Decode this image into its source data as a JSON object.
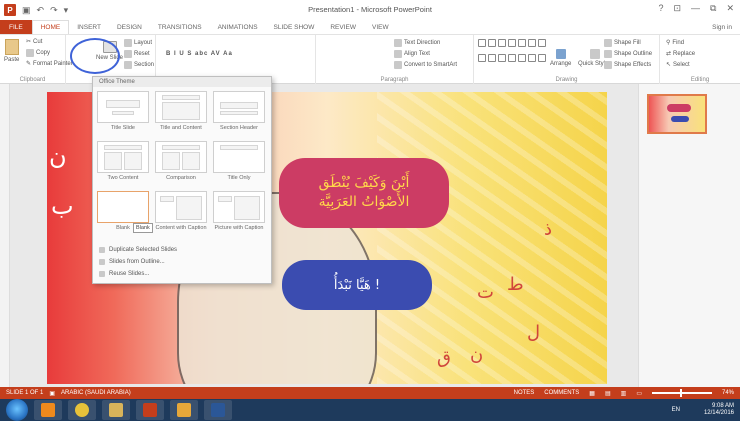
{
  "window": {
    "title": "Presentation1 - Microsoft PowerPoint",
    "controls": [
      "?",
      "⊡",
      "—",
      "⧉",
      "✕"
    ],
    "sign_in": "Sign in"
  },
  "tabs": [
    "FILE",
    "HOME",
    "INSERT",
    "DESIGN",
    "TRANSITIONS",
    "ANIMATIONS",
    "SLIDE SHOW",
    "REVIEW",
    "VIEW"
  ],
  "ribbon": {
    "clipboard": {
      "paste": "Paste",
      "cut": "Cut",
      "copy": "Copy",
      "format_painter": "Format Painter",
      "label": "Clipboard"
    },
    "slides": {
      "new_slide": "New Slide",
      "layout": "Layout",
      "reset": "Reset",
      "section": "Section"
    },
    "font": {
      "buttons": "B  I  U  S  abc  AV  Aa"
    },
    "paragraph": {
      "label": "Paragraph",
      "text_direction": "Text Direction",
      "align_text": "Align Text",
      "convert": "Convert to SmartArt"
    },
    "drawing": {
      "arrange": "Arrange",
      "quick_styles": "Quick Styles",
      "shape_fill": "Shape Fill",
      "shape_outline": "Shape Outline",
      "shape_effects": "Shape Effects",
      "label": "Drawing"
    },
    "editing": {
      "find": "Find",
      "replace": "Replace",
      "select": "Select",
      "label": "Editing"
    }
  },
  "dropdown": {
    "title": "Office Theme",
    "layouts": [
      {
        "label": "Title Slide"
      },
      {
        "label": "Title and Content"
      },
      {
        "label": "Section Header"
      },
      {
        "label": "Two Content"
      },
      {
        "label": "Comparison"
      },
      {
        "label": "Title Only"
      },
      {
        "label": "Blank"
      },
      {
        "label": "Content with Caption"
      },
      {
        "label": "Picture with Caption"
      }
    ],
    "tooltip": "Blank",
    "items": [
      "Duplicate Selected Slides",
      "Slides from Outline...",
      "Reuse Slides..."
    ]
  },
  "slide": {
    "line1": "أَيْنَ وَكَيْفَ يُنْطَق",
    "line2": "الأَصْوَاتُ العَرَبِيَّة",
    "button_text": "هَيَّا نَبْدَأُ !",
    "letters": [
      "ن",
      "ب",
      "ذ",
      "ط",
      "ت",
      "ل",
      "ن",
      "ق"
    ]
  },
  "status": {
    "slide": "SLIDE 1 OF 1",
    "language": "ARABIC (SAUDI ARABIA)",
    "notes": "NOTES",
    "comments": "COMMENTS",
    "zoom": "74%"
  },
  "taskbar": {
    "apps": [
      {
        "name": "vlc",
        "color": "#f08a1c"
      },
      {
        "name": "chrome",
        "color": "#e7c23a"
      },
      {
        "name": "folder",
        "color": "#d9b45a"
      },
      {
        "name": "powerpoint",
        "color": "#c43e1c"
      },
      {
        "name": "camtasia",
        "color": "#e7a83a"
      },
      {
        "name": "word",
        "color": "#2b5797"
      }
    ],
    "lang": "EN",
    "time": "9:08 AM",
    "date": "12/14/2016"
  }
}
